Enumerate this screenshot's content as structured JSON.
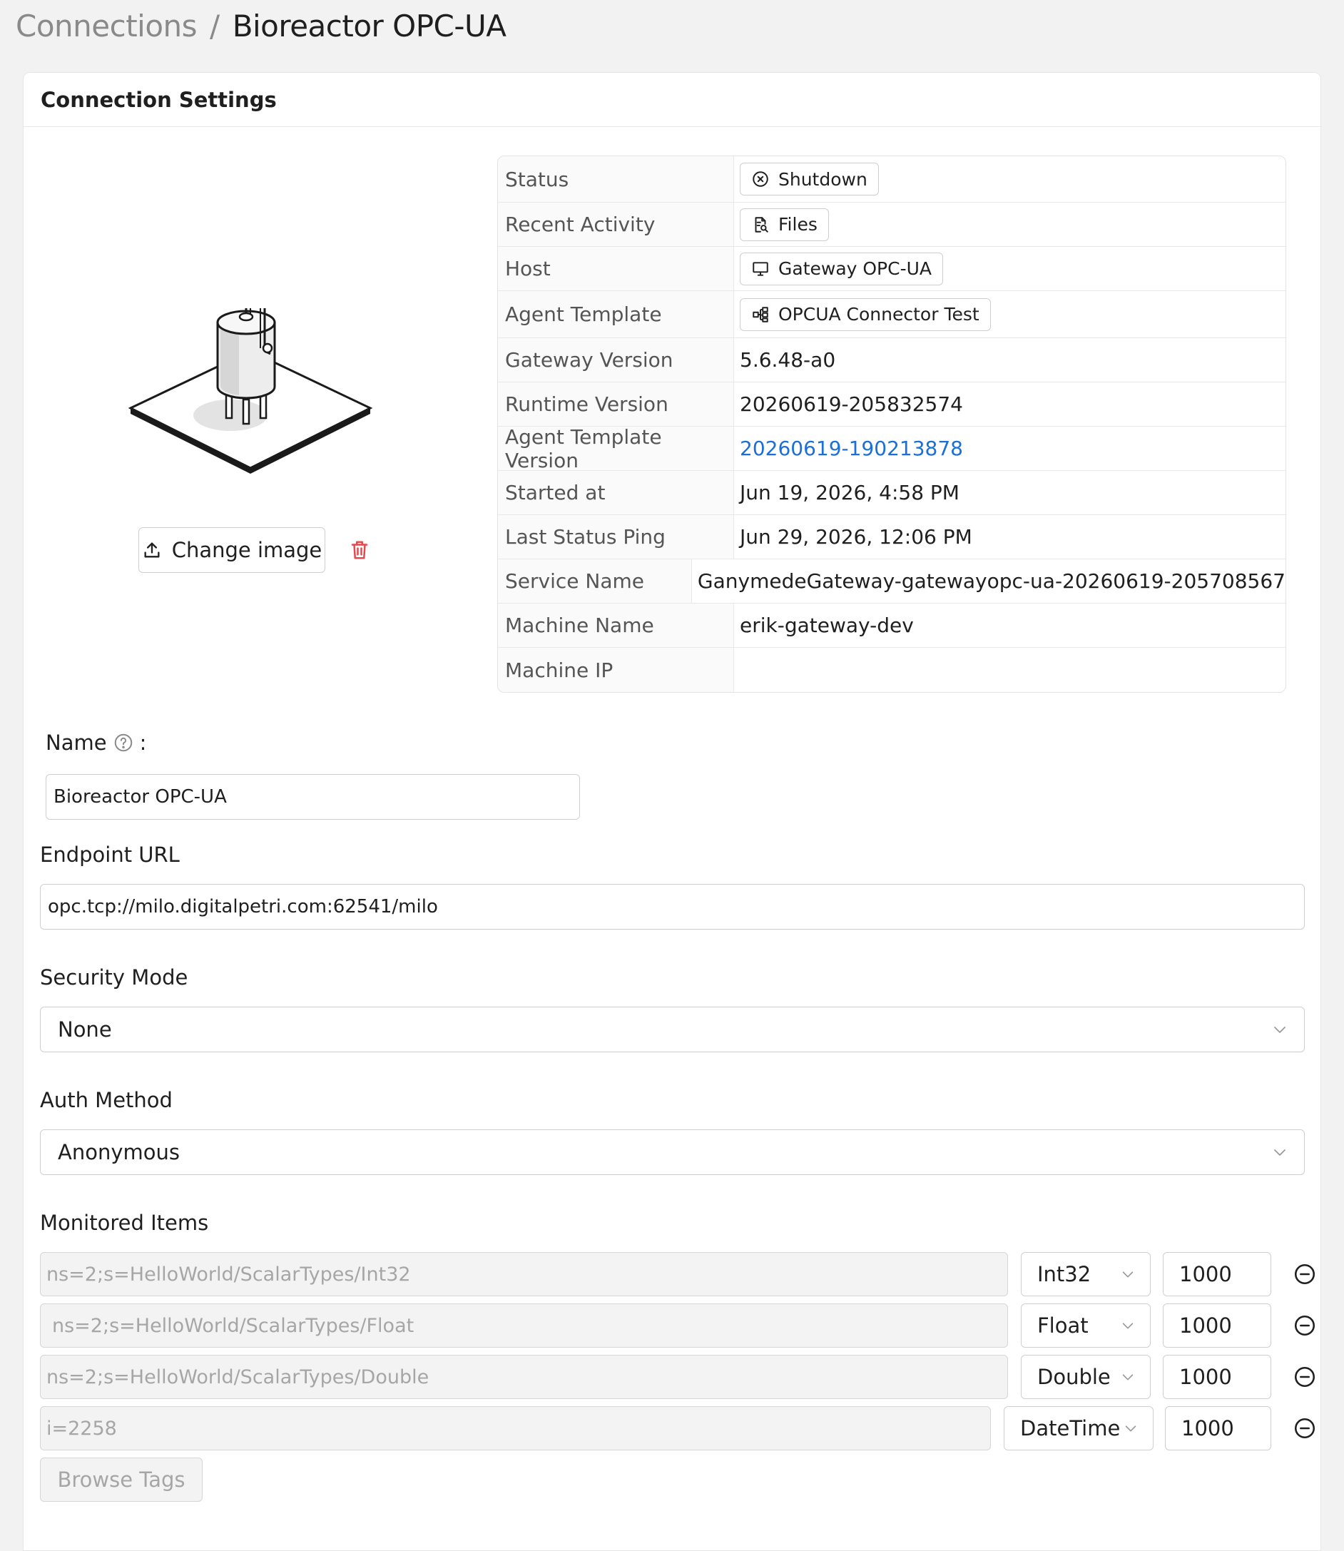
{
  "breadcrumb": {
    "parent": "Connections",
    "separator": "/",
    "current": "Bioreactor OPC-UA"
  },
  "card": {
    "title": "Connection Settings"
  },
  "image": {
    "change_label": "Change image",
    "illustration_icon": "bioreactor-tank-illustration",
    "delete_icon": "trash-icon"
  },
  "info": {
    "status_label": "Status",
    "status_value": "Shutdown",
    "status_icon": "circle-x-icon",
    "activity_label": "Recent Activity",
    "activity_value": "Files",
    "activity_icon": "file-search-icon",
    "host_label": "Host",
    "host_value": "Gateway OPC-UA",
    "host_icon": "monitor-icon",
    "template_label": "Agent Template",
    "template_value": "OPCUA Connector Test",
    "template_icon": "hierarchy-icon",
    "gateway_version_label": "Gateway Version",
    "gateway_version_value": "5.6.48-a0",
    "runtime_version_label": "Runtime Version",
    "runtime_version_value": "20260619-205832574",
    "template_version_label": "Agent Template Version",
    "template_version_value": "20260619-190213878",
    "started_label": "Started at",
    "started_value": "Jun 19, 2026, 4:58 PM",
    "ping_label": "Last Status Ping",
    "ping_value": "Jun 29, 2026, 12:06 PM",
    "service_label": "Service Name",
    "service_value": "GanymedeGateway-gatewayopc-ua-20260619-205708567",
    "machine_label": "Machine Name",
    "machine_value": "erik-gateway-dev",
    "ip_label": "Machine IP",
    "ip_value": ""
  },
  "form": {
    "name_label": "Name",
    "name_colon": ":",
    "name_value": "Bioreactor OPC-UA",
    "endpoint_label": "Endpoint URL",
    "endpoint_value": "opc.tcp://milo.digitalpetri.com:62541/milo",
    "security_label": "Security Mode",
    "security_value": "None",
    "auth_label": "Auth Method",
    "auth_value": "Anonymous",
    "monitored_label": "Monitored Items",
    "browse_label": "Browse Tags"
  },
  "monitored_items": [
    {
      "node": "ns=2;s=HelloWorld/ScalarTypes/Int32",
      "type": "Int32",
      "rate": "1000"
    },
    {
      "node": "ns=2;s=HelloWorld/ScalarTypes/Float",
      "type": "Float",
      "rate": "1000"
    },
    {
      "node": "ns=2;s=HelloWorld/ScalarTypes/Double",
      "type": "Double",
      "rate": "1000"
    },
    {
      "node": "i=2258",
      "type": "DateTime",
      "rate": "1000"
    }
  ],
  "colors": {
    "link": "#1a6fd8",
    "danger": "#e5484d",
    "background": "#f2f2f2"
  }
}
